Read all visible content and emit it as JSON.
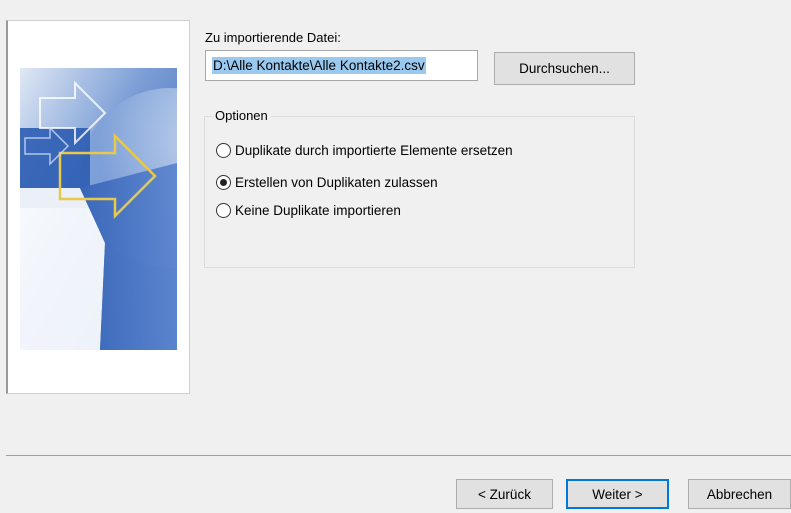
{
  "file_section": {
    "label": "Zu importierende Datei:",
    "path_value": "D:\\Alle Kontakte\\Alle Kontakte2.csv",
    "browse_label": "Durchsuchen..."
  },
  "options": {
    "legend": "Optionen",
    "items": [
      {
        "label": "Duplikate durch importierte Elemente ersetzen",
        "checked": false
      },
      {
        "label": "Erstellen von Duplikaten zulassen",
        "checked": true
      },
      {
        "label": "Keine Duplikate importieren",
        "checked": false
      }
    ]
  },
  "footer": {
    "back_label": "< Zurück",
    "next_label": "Weiter >",
    "cancel_label": "Abbrechen"
  },
  "colors": {
    "selection": "#99c9ef",
    "primary_border": "#0078d7",
    "graphic_blue": "#3f6fc0"
  },
  "icons": {
    "wizard_graphic": "import-wizard-arrows-graphic"
  }
}
